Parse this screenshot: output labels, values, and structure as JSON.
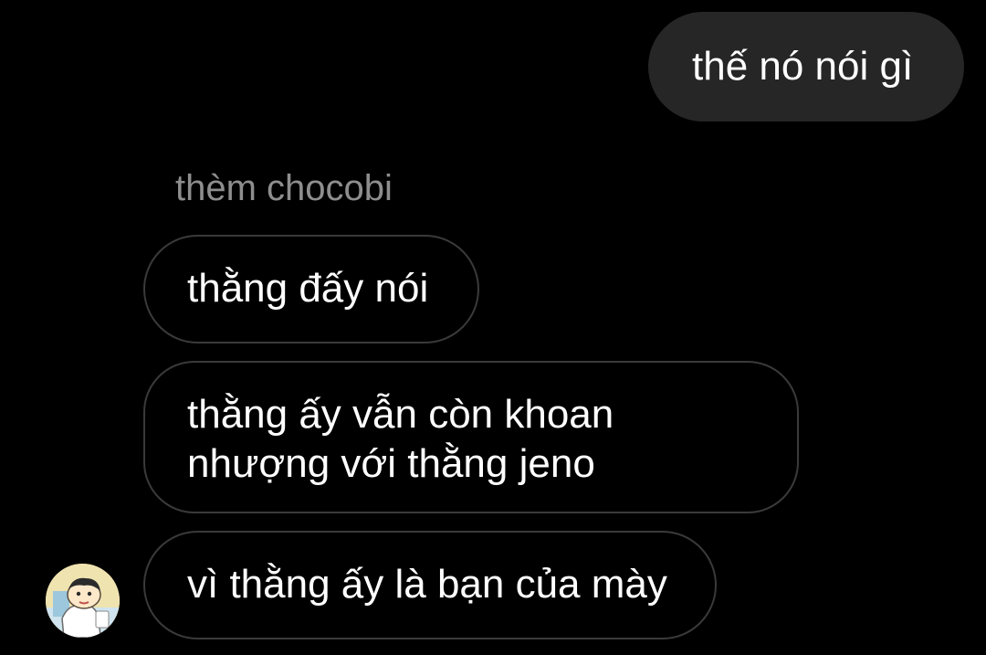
{
  "conversation": {
    "outgoing": [
      {
        "text": "thế nó nói gì"
      }
    ],
    "sender_name": "thèm chocobi",
    "incoming": [
      {
        "lines": [
          "thằng đấy nói"
        ]
      },
      {
        "lines": [
          "thằng ấy vẫn còn khoan",
          "nhượng với thằng jeno"
        ]
      },
      {
        "lines": [
          "vì thằng ấy là bạn của mày"
        ]
      }
    ],
    "avatar_icon": "cartoon-avatar-icon"
  },
  "colors": {
    "background": "#000000",
    "outgoing_bubble": "#262626",
    "incoming_border": "#3a3a3a",
    "sender_name": "#8e8e8e",
    "text": "#ffffff"
  }
}
